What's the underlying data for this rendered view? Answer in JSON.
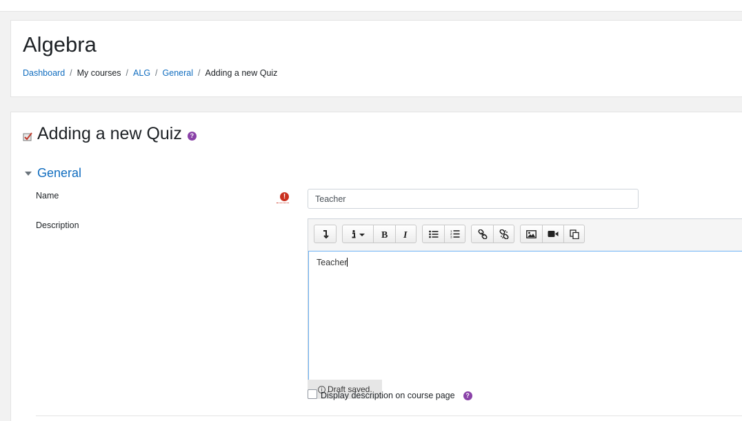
{
  "header": {
    "course_title": "Algebra",
    "breadcrumb": {
      "dashboard": "Dashboard",
      "my_courses": "My courses",
      "course_short": "ALG",
      "section": "General",
      "current": "Adding a new Quiz",
      "separator": "/"
    }
  },
  "form": {
    "page_title": "Adding a new Quiz",
    "help_glyph": "?",
    "section_title": "General",
    "name_label": "Name",
    "required_glyph": "!",
    "name_value": "Teacher",
    "description_label": "Description",
    "description_content": "Teacher",
    "draft_notice": "Draft saved.",
    "display_description_label": "Display description on course page"
  },
  "toolbar": {
    "icons": [
      "collapse-icon",
      "info-icon",
      "bold-icon",
      "italic-icon",
      "unordered-list-icon",
      "ordered-list-icon",
      "link-icon",
      "unlink-icon",
      "image-icon",
      "video-icon",
      "paste-icon"
    ]
  },
  "colors": {
    "link": "#0f6cbf",
    "help": "#8a42a8",
    "required": "#ca3120",
    "editor_focus": "#6eb2f4"
  }
}
